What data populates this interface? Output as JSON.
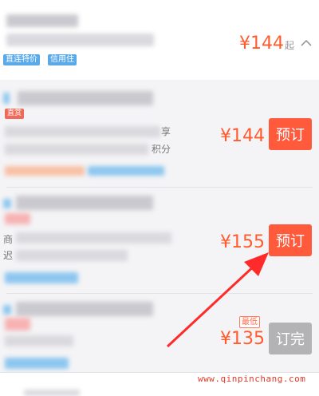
{
  "hotel": {
    "tags": [
      "直连特价",
      "信用住"
    ],
    "price": "¥144",
    "price_suffix": "起",
    "collapse_icon": "chevron-up-icon"
  },
  "rooms": [
    {
      "badge": "直赏",
      "text_fragment_1": "享",
      "text_fragment_2": "积分",
      "price": "¥144",
      "button_label": "预订",
      "button_state": "active"
    },
    {
      "text_fragment_1": "商",
      "text_fragment_2": "迟",
      "price": "¥155",
      "button_label": "预订",
      "button_state": "active"
    },
    {
      "lowest_badge": "最低",
      "price": "¥135",
      "button_label": "订完",
      "button_state": "disabled"
    }
  ],
  "annotation": {
    "type": "arrow",
    "color": "#ff2a2a"
  },
  "watermark": "www.qinpinchang.com",
  "colors": {
    "accent": "#ff5a3c",
    "price": "#ff5b2e",
    "disabled": "#b3b3b6"
  }
}
